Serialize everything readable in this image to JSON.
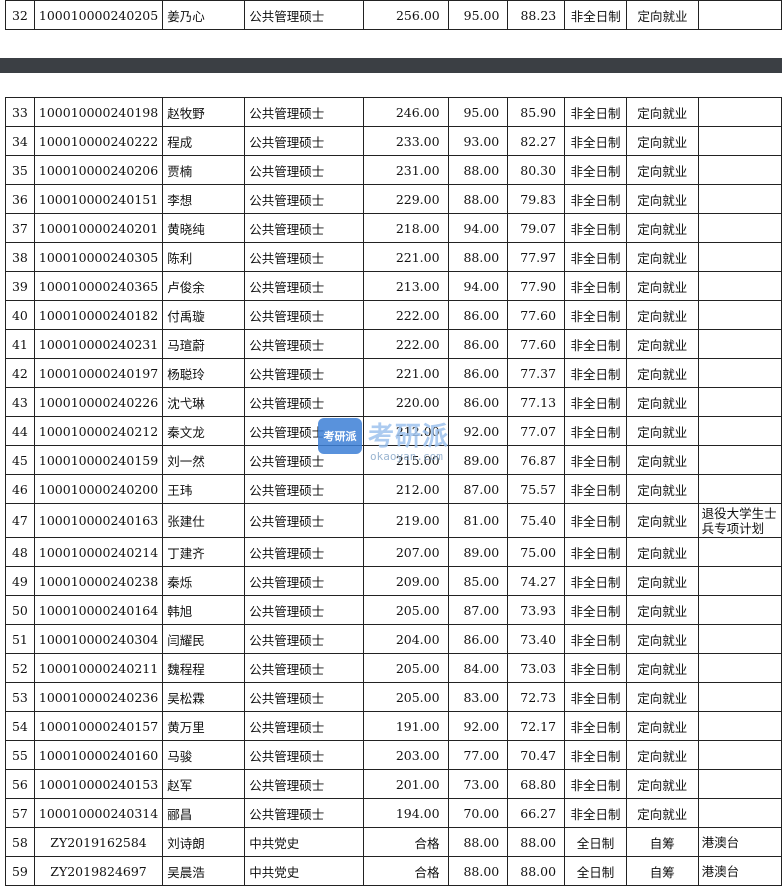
{
  "top_rows": [
    [
      "32",
      "100010000240205",
      "姜乃心",
      "公共管理硕士",
      "256.00",
      "95.00",
      "88.23",
      "非全日制",
      "定向就业",
      ""
    ]
  ],
  "rows": [
    [
      "33",
      "100010000240198",
      "赵牧野",
      "公共管理硕士",
      "246.00",
      "95.00",
      "85.90",
      "非全日制",
      "定向就业",
      ""
    ],
    [
      "34",
      "100010000240222",
      "程成",
      "公共管理硕士",
      "233.00",
      "93.00",
      "82.27",
      "非全日制",
      "定向就业",
      ""
    ],
    [
      "35",
      "100010000240206",
      "贾楠",
      "公共管理硕士",
      "231.00",
      "88.00",
      "80.30",
      "非全日制",
      "定向就业",
      ""
    ],
    [
      "36",
      "100010000240151",
      "李想",
      "公共管理硕士",
      "229.00",
      "88.00",
      "79.83",
      "非全日制",
      "定向就业",
      ""
    ],
    [
      "37",
      "100010000240201",
      "黄晓纯",
      "公共管理硕士",
      "218.00",
      "94.00",
      "79.07",
      "非全日制",
      "定向就业",
      ""
    ],
    [
      "38",
      "100010000240305",
      "陈利",
      "公共管理硕士",
      "221.00",
      "88.00",
      "77.97",
      "非全日制",
      "定向就业",
      ""
    ],
    [
      "39",
      "100010000240365",
      "卢俊余",
      "公共管理硕士",
      "213.00",
      "94.00",
      "77.90",
      "非全日制",
      "定向就业",
      ""
    ],
    [
      "40",
      "100010000240182",
      "付禹璇",
      "公共管理硕士",
      "222.00",
      "86.00",
      "77.60",
      "非全日制",
      "定向就业",
      ""
    ],
    [
      "41",
      "100010000240231",
      "马瑄蔚",
      "公共管理硕士",
      "222.00",
      "86.00",
      "77.60",
      "非全日制",
      "定向就业",
      ""
    ],
    [
      "42",
      "100010000240197",
      "杨聪玲",
      "公共管理硕士",
      "221.00",
      "86.00",
      "77.37",
      "非全日制",
      "定向就业",
      ""
    ],
    [
      "43",
      "100010000240226",
      "沈弋琳",
      "公共管理硕士",
      "220.00",
      "86.00",
      "77.13",
      "非全日制",
      "定向就业",
      ""
    ],
    [
      "44",
      "100010000240212",
      "秦文龙",
      "公共管理硕士",
      "212.00",
      "92.00",
      "77.07",
      "非全日制",
      "定向就业",
      ""
    ],
    [
      "45",
      "100010000240159",
      "刘一然",
      "公共管理硕士",
      "215.00",
      "89.00",
      "76.87",
      "非全日制",
      "定向就业",
      ""
    ],
    [
      "46",
      "100010000240200",
      "王玮",
      "公共管理硕士",
      "212.00",
      "87.00",
      "75.57",
      "非全日制",
      "定向就业",
      ""
    ],
    [
      "47",
      "100010000240163",
      "张建仕",
      "公共管理硕士",
      "219.00",
      "81.00",
      "75.40",
      "非全日制",
      "定向就业",
      "退役大学生士兵专项计划"
    ],
    [
      "48",
      "100010000240214",
      "丁建齐",
      "公共管理硕士",
      "207.00",
      "89.00",
      "75.00",
      "非全日制",
      "定向就业",
      ""
    ],
    [
      "49",
      "100010000240238",
      "秦烁",
      "公共管理硕士",
      "209.00",
      "85.00",
      "74.27",
      "非全日制",
      "定向就业",
      ""
    ],
    [
      "50",
      "100010000240164",
      "韩旭",
      "公共管理硕士",
      "205.00",
      "87.00",
      "73.93",
      "非全日制",
      "定向就业",
      ""
    ],
    [
      "51",
      "100010000240304",
      "闫耀民",
      "公共管理硕士",
      "204.00",
      "86.00",
      "73.40",
      "非全日制",
      "定向就业",
      ""
    ],
    [
      "52",
      "100010000240211",
      "魏程程",
      "公共管理硕士",
      "205.00",
      "84.00",
      "73.03",
      "非全日制",
      "定向就业",
      ""
    ],
    [
      "53",
      "100010000240236",
      "吴松霖",
      "公共管理硕士",
      "205.00",
      "83.00",
      "72.73",
      "非全日制",
      "定向就业",
      ""
    ],
    [
      "54",
      "100010000240157",
      "黄万里",
      "公共管理硕士",
      "191.00",
      "92.00",
      "72.17",
      "非全日制",
      "定向就业",
      ""
    ],
    [
      "55",
      "100010000240160",
      "马骏",
      "公共管理硕士",
      "203.00",
      "77.00",
      "70.47",
      "非全日制",
      "定向就业",
      ""
    ],
    [
      "56",
      "100010000240153",
      "赵军",
      "公共管理硕士",
      "201.00",
      "73.00",
      "68.80",
      "非全日制",
      "定向就业",
      ""
    ],
    [
      "57",
      "100010000240314",
      "郦昌",
      "公共管理硕士",
      "194.00",
      "70.00",
      "66.27",
      "非全日制",
      "定向就业",
      ""
    ],
    [
      "58",
      "ZY2019162584",
      "刘诗朗",
      "中共党史",
      "合格",
      "88.00",
      "88.00",
      "全日制",
      "自筹",
      "港澳台"
    ],
    [
      "59",
      "ZY2019824697",
      "吴晨浩",
      "中共党史",
      "合格",
      "88.00",
      "88.00",
      "全日制",
      "自筹",
      "港澳台"
    ]
  ],
  "watermark": {
    "logo": "考研派",
    "title": "考研派",
    "url": "okaoyan.com"
  }
}
